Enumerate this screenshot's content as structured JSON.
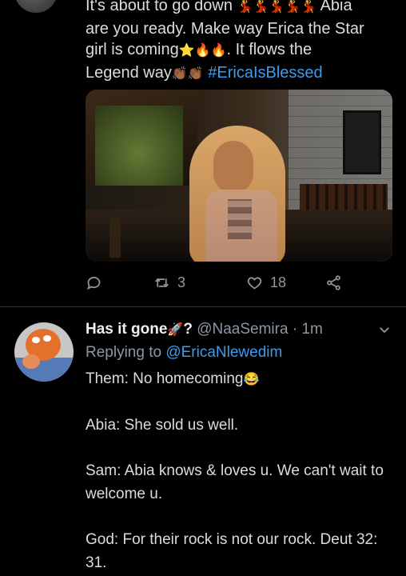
{
  "tweet1": {
    "text": {
      "line1": "It's about to go down",
      "word_abia": " Abia",
      "line2": "are you ready. Make way Erica the Star",
      "line3a": "girl is coming",
      "line3b": ". It flows the",
      "line4": "Legend way",
      "hashtag": "#EricaIsBlessed"
    },
    "actions": {
      "retweets": "3",
      "likes": "18"
    }
  },
  "tweet2": {
    "name": "Has it gone",
    "name_q": "?",
    "handle": "@NaaSemira",
    "separator": "·",
    "time": "1m",
    "replying_prefix": "Replying to",
    "replying_mention": "@EricaNlewedim",
    "lines": [
      "Them: No homecoming",
      "Abia: She sold us well.",
      "Sam: Abia knows & loves u. We can't wait to welcome u.",
      "God: For their rock is not our rock. Deut 32: 31."
    ]
  },
  "icons": [
    "dancer-emoji",
    "star-emoji",
    "fire-emoji",
    "clap-emoji",
    "rocket-emoji",
    "laughing-emoji",
    "reply-icon",
    "retweet-icon",
    "heart-icon",
    "share-icon",
    "chevron-down-icon"
  ],
  "colors": {
    "background": "#000000",
    "text": "#dcdcdc",
    "muted": "#8b98a5",
    "link": "#3b9cf0"
  }
}
